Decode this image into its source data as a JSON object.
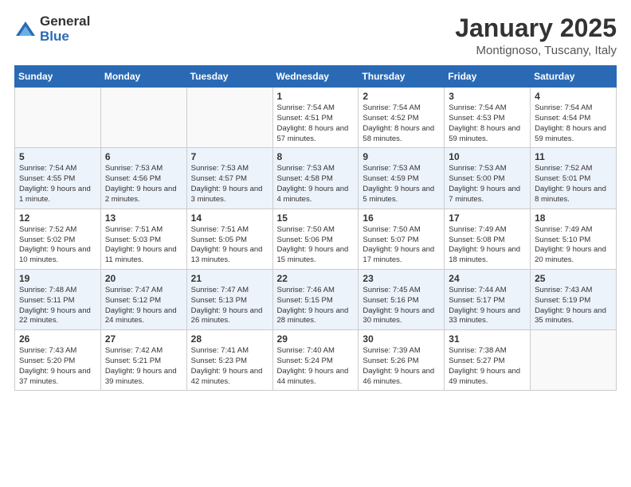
{
  "logo": {
    "general": "General",
    "blue": "Blue"
  },
  "header": {
    "month": "January 2025",
    "location": "Montignoso, Tuscany, Italy"
  },
  "days_of_week": [
    "Sunday",
    "Monday",
    "Tuesday",
    "Wednesday",
    "Thursday",
    "Friday",
    "Saturday"
  ],
  "weeks": [
    [
      {
        "day": "",
        "info": ""
      },
      {
        "day": "",
        "info": ""
      },
      {
        "day": "",
        "info": ""
      },
      {
        "day": "1",
        "info": "Sunrise: 7:54 AM\nSunset: 4:51 PM\nDaylight: 8 hours and 57 minutes."
      },
      {
        "day": "2",
        "info": "Sunrise: 7:54 AM\nSunset: 4:52 PM\nDaylight: 8 hours and 58 minutes."
      },
      {
        "day": "3",
        "info": "Sunrise: 7:54 AM\nSunset: 4:53 PM\nDaylight: 8 hours and 59 minutes."
      },
      {
        "day": "4",
        "info": "Sunrise: 7:54 AM\nSunset: 4:54 PM\nDaylight: 8 hours and 59 minutes."
      }
    ],
    [
      {
        "day": "5",
        "info": "Sunrise: 7:54 AM\nSunset: 4:55 PM\nDaylight: 9 hours and 1 minute."
      },
      {
        "day": "6",
        "info": "Sunrise: 7:53 AM\nSunset: 4:56 PM\nDaylight: 9 hours and 2 minutes."
      },
      {
        "day": "7",
        "info": "Sunrise: 7:53 AM\nSunset: 4:57 PM\nDaylight: 9 hours and 3 minutes."
      },
      {
        "day": "8",
        "info": "Sunrise: 7:53 AM\nSunset: 4:58 PM\nDaylight: 9 hours and 4 minutes."
      },
      {
        "day": "9",
        "info": "Sunrise: 7:53 AM\nSunset: 4:59 PM\nDaylight: 9 hours and 5 minutes."
      },
      {
        "day": "10",
        "info": "Sunrise: 7:53 AM\nSunset: 5:00 PM\nDaylight: 9 hours and 7 minutes."
      },
      {
        "day": "11",
        "info": "Sunrise: 7:52 AM\nSunset: 5:01 PM\nDaylight: 9 hours and 8 minutes."
      }
    ],
    [
      {
        "day": "12",
        "info": "Sunrise: 7:52 AM\nSunset: 5:02 PM\nDaylight: 9 hours and 10 minutes."
      },
      {
        "day": "13",
        "info": "Sunrise: 7:51 AM\nSunset: 5:03 PM\nDaylight: 9 hours and 11 minutes."
      },
      {
        "day": "14",
        "info": "Sunrise: 7:51 AM\nSunset: 5:05 PM\nDaylight: 9 hours and 13 minutes."
      },
      {
        "day": "15",
        "info": "Sunrise: 7:50 AM\nSunset: 5:06 PM\nDaylight: 9 hours and 15 minutes."
      },
      {
        "day": "16",
        "info": "Sunrise: 7:50 AM\nSunset: 5:07 PM\nDaylight: 9 hours and 17 minutes."
      },
      {
        "day": "17",
        "info": "Sunrise: 7:49 AM\nSunset: 5:08 PM\nDaylight: 9 hours and 18 minutes."
      },
      {
        "day": "18",
        "info": "Sunrise: 7:49 AM\nSunset: 5:10 PM\nDaylight: 9 hours and 20 minutes."
      }
    ],
    [
      {
        "day": "19",
        "info": "Sunrise: 7:48 AM\nSunset: 5:11 PM\nDaylight: 9 hours and 22 minutes."
      },
      {
        "day": "20",
        "info": "Sunrise: 7:47 AM\nSunset: 5:12 PM\nDaylight: 9 hours and 24 minutes."
      },
      {
        "day": "21",
        "info": "Sunrise: 7:47 AM\nSunset: 5:13 PM\nDaylight: 9 hours and 26 minutes."
      },
      {
        "day": "22",
        "info": "Sunrise: 7:46 AM\nSunset: 5:15 PM\nDaylight: 9 hours and 28 minutes."
      },
      {
        "day": "23",
        "info": "Sunrise: 7:45 AM\nSunset: 5:16 PM\nDaylight: 9 hours and 30 minutes."
      },
      {
        "day": "24",
        "info": "Sunrise: 7:44 AM\nSunset: 5:17 PM\nDaylight: 9 hours and 33 minutes."
      },
      {
        "day": "25",
        "info": "Sunrise: 7:43 AM\nSunset: 5:19 PM\nDaylight: 9 hours and 35 minutes."
      }
    ],
    [
      {
        "day": "26",
        "info": "Sunrise: 7:43 AM\nSunset: 5:20 PM\nDaylight: 9 hours and 37 minutes."
      },
      {
        "day": "27",
        "info": "Sunrise: 7:42 AM\nSunset: 5:21 PM\nDaylight: 9 hours and 39 minutes."
      },
      {
        "day": "28",
        "info": "Sunrise: 7:41 AM\nSunset: 5:23 PM\nDaylight: 9 hours and 42 minutes."
      },
      {
        "day": "29",
        "info": "Sunrise: 7:40 AM\nSunset: 5:24 PM\nDaylight: 9 hours and 44 minutes."
      },
      {
        "day": "30",
        "info": "Sunrise: 7:39 AM\nSunset: 5:26 PM\nDaylight: 9 hours and 46 minutes."
      },
      {
        "day": "31",
        "info": "Sunrise: 7:38 AM\nSunset: 5:27 PM\nDaylight: 9 hours and 49 minutes."
      },
      {
        "day": "",
        "info": ""
      }
    ]
  ]
}
